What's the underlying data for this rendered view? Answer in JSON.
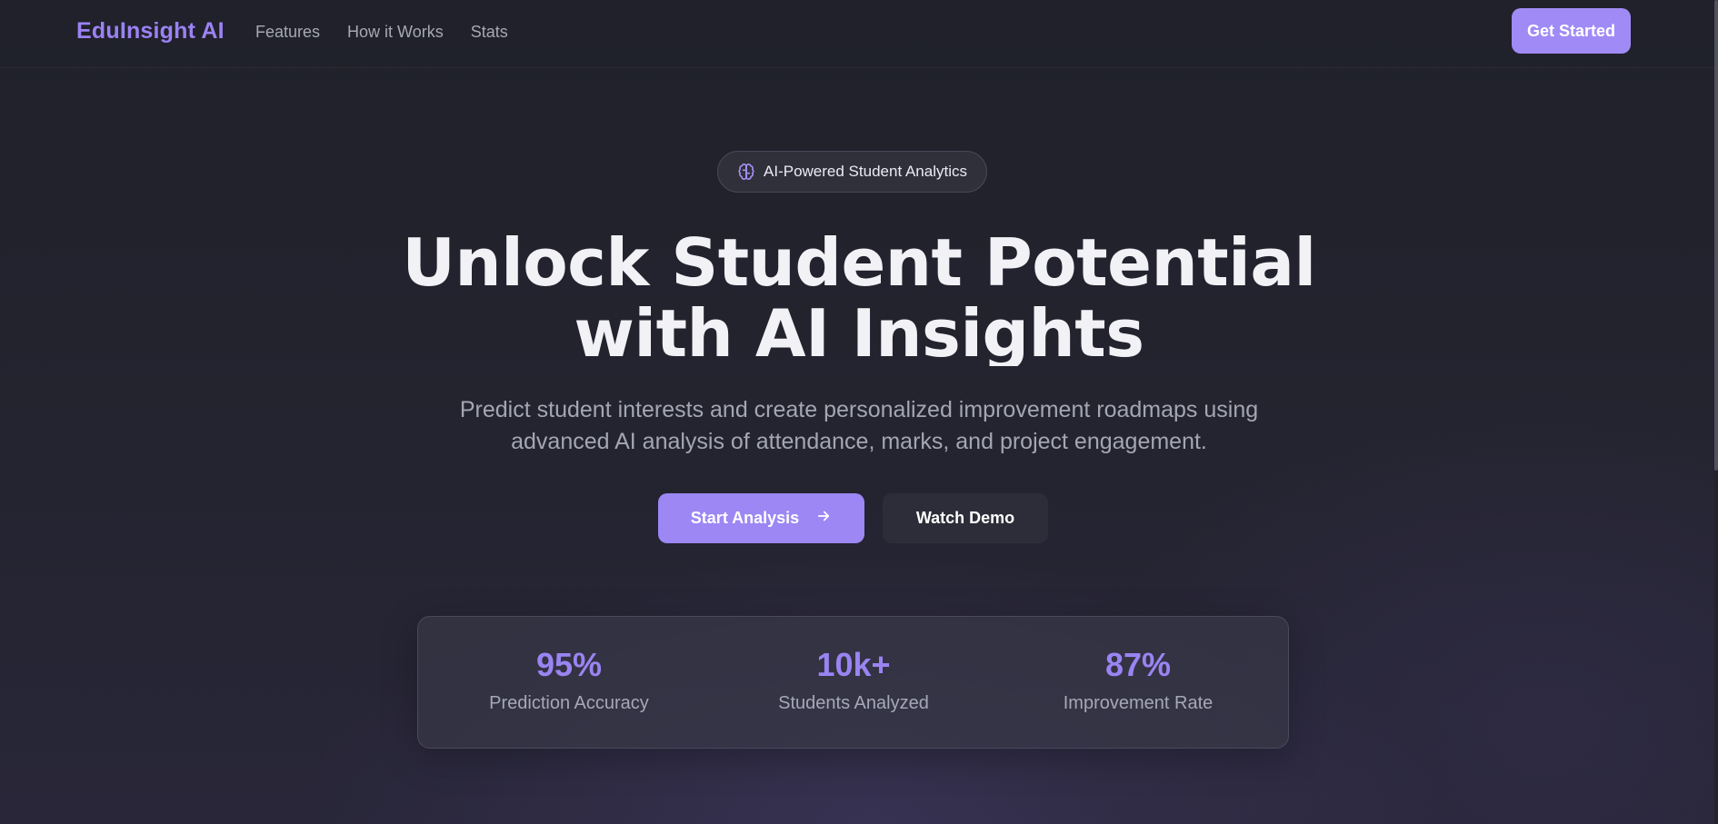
{
  "header": {
    "brand": "EduInsight AI",
    "nav": [
      {
        "label": "Features"
      },
      {
        "label": "How it Works"
      },
      {
        "label": "Stats"
      }
    ],
    "cta_label": "Get Started"
  },
  "hero": {
    "badge": {
      "icon": "brain-icon",
      "label": "AI-Powered Student Analytics"
    },
    "title_line1": "Unlock Student Potential",
    "title_line2": "with AI Insights",
    "subtitle_line1": "Predict student interests and create personalized improvement roadmaps using",
    "subtitle_line2": "advanced AI analysis of attendance, marks, and project engagement.",
    "primary_button": {
      "label": "Start Analysis",
      "icon": "arrow-right-icon"
    },
    "secondary_button": {
      "label": "Watch Demo"
    }
  },
  "stats": [
    {
      "value": "95%",
      "label": "Prediction Accuracy"
    },
    {
      "value": "10k+",
      "label": "Students Analyzed"
    },
    {
      "value": "87%",
      "label": "Improvement Rate"
    }
  ],
  "colors": {
    "accent": "#9b82f3",
    "button_primary": "#9c87f4",
    "background": "#22222b",
    "text_muted": "#a6a8b5"
  }
}
